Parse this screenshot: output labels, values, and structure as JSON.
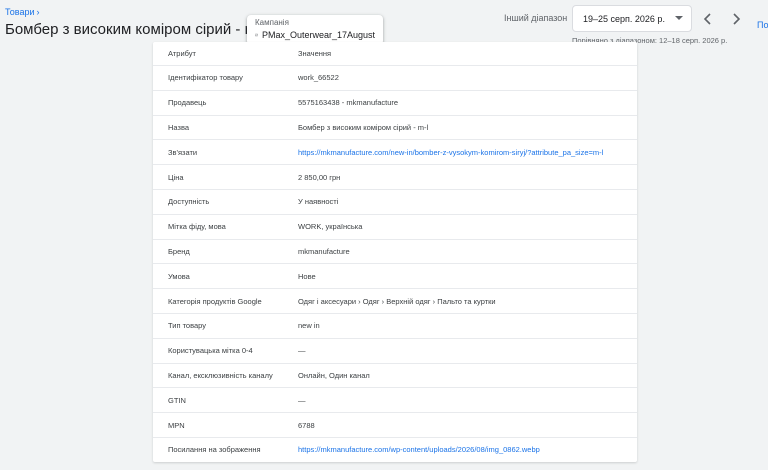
{
  "header": {
    "breadcrumb": "Товари",
    "title": "Бомбер з високим коміром сірий - m-l",
    "campaign_label": "Кампанія",
    "campaign_value": "PMax_Outerwear_17August",
    "other_range_label": "Інший діапазон",
    "date_range": "19–25 серп. 2026 р.",
    "compare_text": "Порівняно з діапазоном: 12–18 серп. 2026 р.",
    "edge_text": "По"
  },
  "table": {
    "head": {
      "key": "Атрибут",
      "value": "Значення"
    },
    "rows": [
      {
        "key": "Ідентифікатор товару",
        "value": "work_66522"
      },
      {
        "key": "Продавець",
        "value": "5575163438 - mkmanufacture"
      },
      {
        "key": "Назва",
        "value": "Бомбер з високим коміром сірий - m-l"
      },
      {
        "key": "Зв'язати",
        "value": "https://mkmanufacture.com/new-in/bomber-z-vysokym-komirom-siryj/?attribute_pa_size=m-l"
      },
      {
        "key": "Ціна",
        "value": "2 850,00 грн"
      },
      {
        "key": "Доступність",
        "value": "У наявності"
      },
      {
        "key": "Мітка фіду, мова",
        "value": "WORK, українська"
      },
      {
        "key": "Бренд",
        "value": "mkmanufacture"
      },
      {
        "key": "Умова",
        "value": "Нове"
      },
      {
        "key": "Категорія продуктів Google",
        "value": "Одяг і аксесуари › Одяг › Верхній одяг › Пальто та куртки"
      },
      {
        "key": "Тип товару",
        "value": "new in"
      },
      {
        "key": "Користувацька мітка 0-4",
        "value": "—"
      },
      {
        "key": "Канал, ексклюзивність каналу",
        "value": "Онлайн, Один канал"
      },
      {
        "key": "GTIN",
        "value": "—"
      },
      {
        "key": "MPN",
        "value": "6788"
      },
      {
        "key": "Посилання на зображення",
        "value": "https://mkmanufacture.com/wp-content/uploads/2026/08/img_0862.webp"
      }
    ]
  },
  "colors": {
    "link": "#1a73e8",
    "background": "#f1f3f4"
  },
  "icons": {
    "campaign": "campaign-icon",
    "prev": "chevron-left-icon",
    "next": "chevron-right-icon",
    "dropdown": "dropdown-arrow-icon"
  }
}
